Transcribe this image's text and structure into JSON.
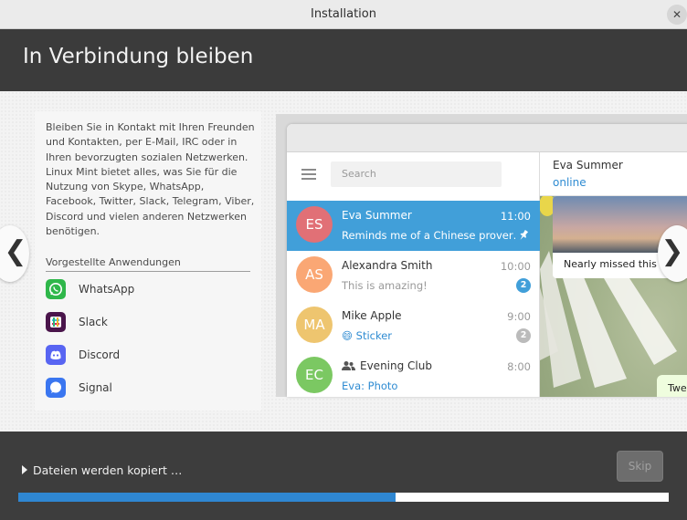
{
  "window": {
    "title": "Installation",
    "close_glyph": "✕"
  },
  "header": {
    "title": "In Verbindung bleiben"
  },
  "description": "Bleiben Sie in Kontakt mit Ihren Freunden und Kontakten, per E-Mail, IRC oder in Ihren bevorzugten sozialen Netzwerken. Linux Mint bietet alles, was Sie für die Nutzung von Skype, WhatsApp, Facebook, Twitter, Slack, Telegram, Viber, Discord und vielen anderen Netzwerken benötigen.",
  "featured": {
    "title": "Vorgestellte Anwendungen",
    "apps": [
      {
        "name": "WhatsApp",
        "icon": "whatsapp-icon",
        "color": "#2fb74a"
      },
      {
        "name": "Slack",
        "icon": "slack-icon",
        "color": "#4a154b"
      },
      {
        "name": "Discord",
        "icon": "discord-icon",
        "color": "#5865f2"
      },
      {
        "name": "Signal",
        "icon": "signal-icon",
        "color": "#3a76f0"
      }
    ]
  },
  "nav": {
    "prev": "❮",
    "next": "❯"
  },
  "telegram": {
    "search_placeholder": "Search",
    "chats": [
      {
        "initials": "ES",
        "name": "Eva Summer",
        "time": "11:00",
        "message": "Reminds me of a Chinese prover…",
        "avatar_color": "#e17076",
        "active": true,
        "pinned": true
      },
      {
        "initials": "AS",
        "name": "Alexandra Smith",
        "time": "10:00",
        "message": "This is amazing!",
        "avatar_color": "#faa774",
        "badge": "2"
      },
      {
        "initials": "MA",
        "name": "Mike Apple",
        "time": "9:00",
        "message": "😄 Sticker",
        "avatar_color": "#eec56f",
        "badge": "2"
      },
      {
        "initials": "EC",
        "name": "Evening Club",
        "time": "8:00",
        "message": "Eva: Photo",
        "avatar_color": "#7bc862"
      }
    ],
    "conversation": {
      "name": "Eva Summer",
      "status": "online",
      "photo_caption": "Nearly missed this s",
      "bubble_text": "Twe"
    }
  },
  "footer": {
    "status": "Dateien werden kopiert …",
    "skip_label": "Skip",
    "progress": 0.58
  },
  "colors": {
    "accent": "#2f87d2",
    "telegram_active": "#419fd9",
    "online": "#2e8bd2"
  }
}
